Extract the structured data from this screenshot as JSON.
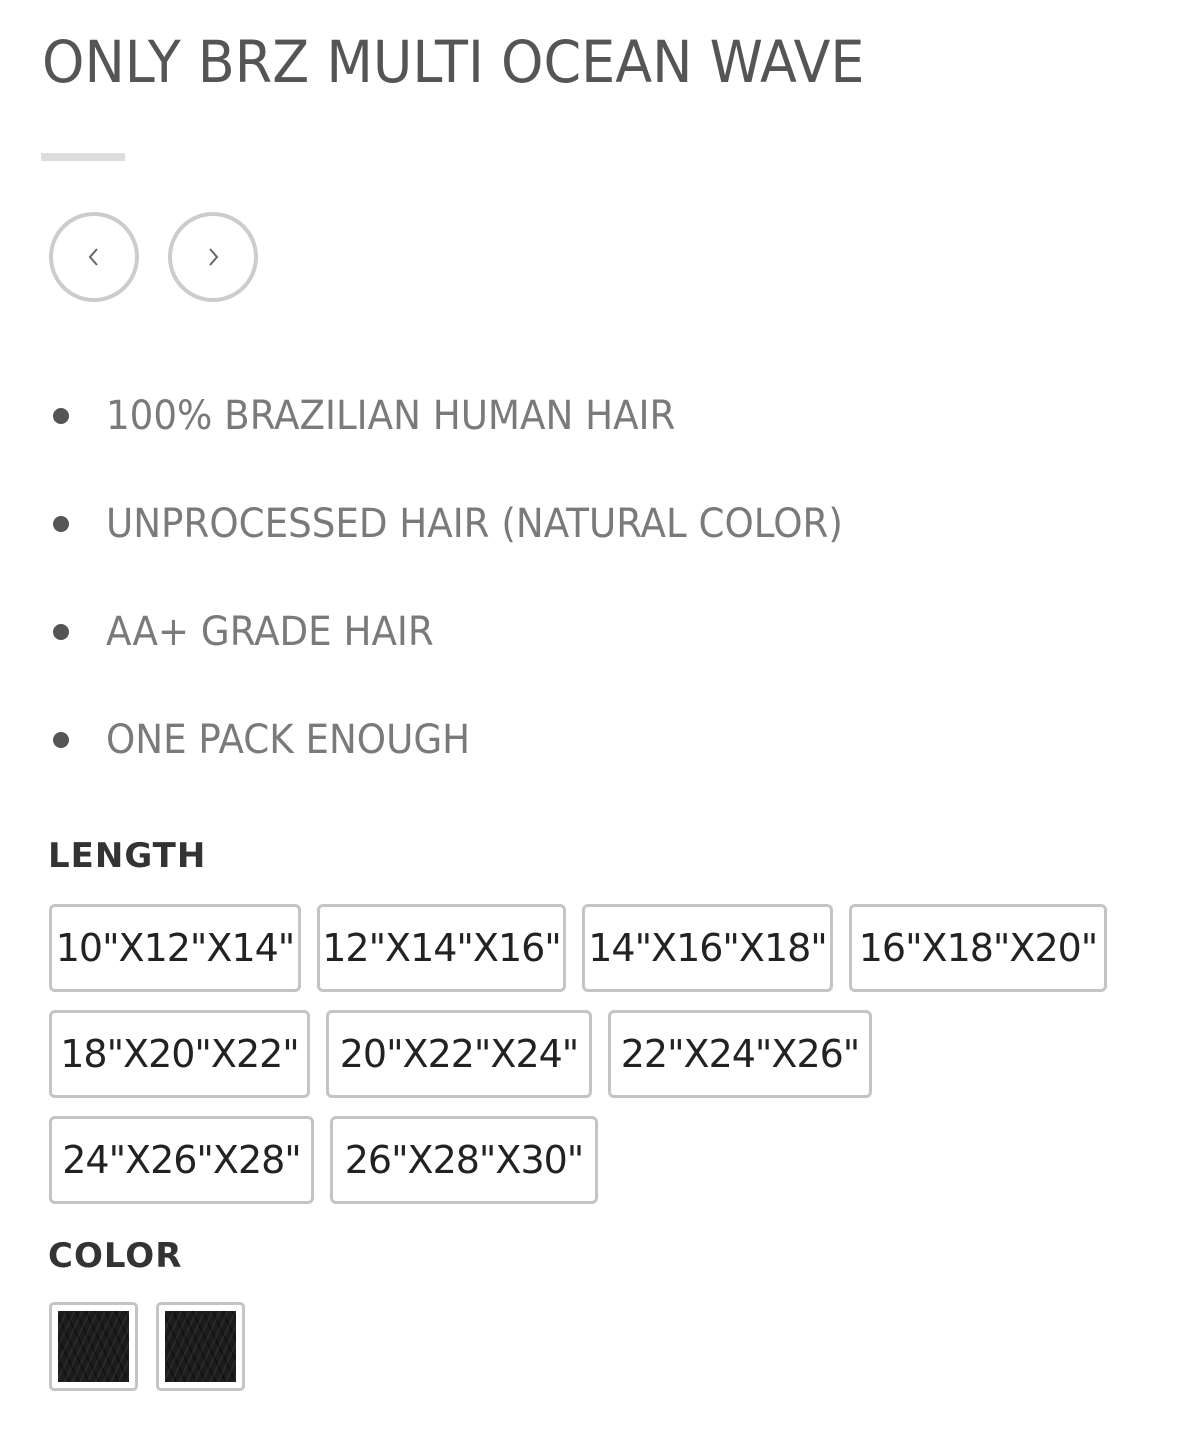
{
  "product": {
    "title": "ONLY BRZ MULTI OCEAN WAVE"
  },
  "gallery_nav": {
    "prev_icon": "chevron-left-icon",
    "next_icon": "chevron-right-icon"
  },
  "features": [
    "100% BRAZILIAN HUMAN HAIR",
    "UNPROCESSED HAIR (NATURAL COLOR)",
    "AA+ GRADE HAIR",
    "ONE PACK ENOUGH"
  ],
  "length": {
    "label": "LENGTH",
    "options": [
      "10\"X12\"X14\"",
      "12\"X14\"X16\"",
      "14\"X16\"X18\"",
      "16\"X18\"X20\"",
      "18\"X20\"X22\"",
      "20\"X22\"X24\"",
      "22\"X24\"X26\"",
      "24\"X26\"X28\"",
      "26\"X28\"X30\""
    ]
  },
  "color": {
    "label": "COLOR",
    "swatches": [
      "#1c1c1c",
      "#1c1c1c"
    ]
  },
  "colors": {
    "title_text": "#555555",
    "feature_text": "#7a7a7a",
    "option_border": "#c4c4c4",
    "nav_border": "#cccccc"
  }
}
